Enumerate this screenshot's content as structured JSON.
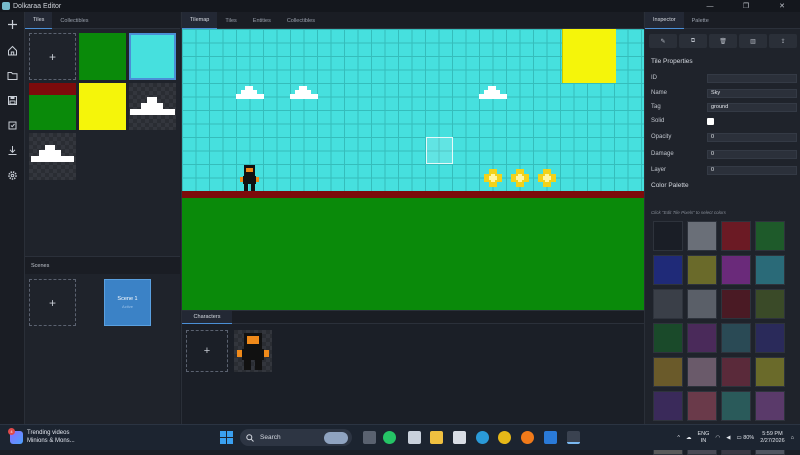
{
  "window": {
    "title": "Dolkaraa Editor",
    "controls": [
      "—",
      "❐",
      "✕"
    ]
  },
  "left_panel": {
    "tabs": [
      {
        "label": "Tiles",
        "active": true
      },
      {
        "label": "Collectibles",
        "active": false
      }
    ],
    "add_symbol": "+",
    "tiles": [
      {
        "kind": "add"
      },
      {
        "kind": "grass",
        "color": "#0a8a0a"
      },
      {
        "kind": "sky",
        "color": "#46e0de",
        "selected": true
      },
      {
        "kind": "ground",
        "color": "#0a8a0a",
        "top_color": "#7d0b0b"
      },
      {
        "kind": "sun",
        "color": "#f5f50a"
      },
      {
        "kind": "cloud"
      },
      {
        "kind": "cloud"
      }
    ],
    "scenes": {
      "header": "Scenes",
      "card": {
        "name": "Scene 1",
        "subtitle": "Active"
      }
    }
  },
  "center": {
    "tabs": [
      {
        "label": "Tilemap",
        "active": true
      },
      {
        "label": "Tiles",
        "active": false
      },
      {
        "label": "Entities",
        "active": false
      },
      {
        "label": "Collectibles",
        "active": false
      }
    ],
    "characters_tab": "Characters",
    "colors": {
      "sky": "#46e0de",
      "ground_line": "#7d0b0b",
      "grass": "#0a8a0a",
      "sun": "#f5f50a",
      "coin": "#f2d21a"
    }
  },
  "inspector": {
    "tabs": [
      {
        "label": "Inspector",
        "active": true
      },
      {
        "label": "Palette",
        "active": false
      }
    ],
    "tools": [
      "pencil-icon",
      "copy-icon",
      "trash-icon",
      "layers-icon",
      "export-icon"
    ],
    "section_title": "Tile Properties",
    "properties": {
      "id": {
        "label": "ID",
        "value": ""
      },
      "name": {
        "label": "Name",
        "value": "Sky"
      },
      "tag": {
        "label": "Tag",
        "value": "ground"
      },
      "solid": {
        "label": "Solid",
        "checked": true
      },
      "opacity": {
        "label": "Opacity",
        "value": "0"
      },
      "damage": {
        "label": "Damage",
        "value": "0"
      },
      "layer": {
        "label": "Layer",
        "value": "0"
      }
    },
    "palette_title": "Color Palette",
    "palette_hint": "Click \"Edit Tile Pixels\" to select colors",
    "palette": [
      "#1a1e26",
      "#6a6f78",
      "#6b1a24",
      "#1e5a2a",
      "#1f2a78",
      "#6a6a2a",
      "#6a2a7a",
      "#2a6a78",
      "#3a3f48",
      "#5a5f68",
      "#4a1a24",
      "#3a4a28",
      "#1a4a2a",
      "#4a2a5a",
      "#2a4a55",
      "#2a2a5a",
      "#6a5a2a",
      "#6a5a6a",
      "#5a2a3a",
      "#6a6a2a",
      "#3a2a5a",
      "#6a3a4a",
      "#2a5a5a",
      "#5a3a6a",
      "#5a5a5a",
      "#4a4a55",
      "#3a3a45",
      "#505560"
    ]
  },
  "taskbar": {
    "widget_title": "Trending videos",
    "widget_subtitle": "Minions & Mons...",
    "widget_badge": "4",
    "search_label": "Search",
    "language": "ENG",
    "region": "IN",
    "battery": "80%",
    "time": "5:59 PM",
    "date": "2/27/2026"
  }
}
